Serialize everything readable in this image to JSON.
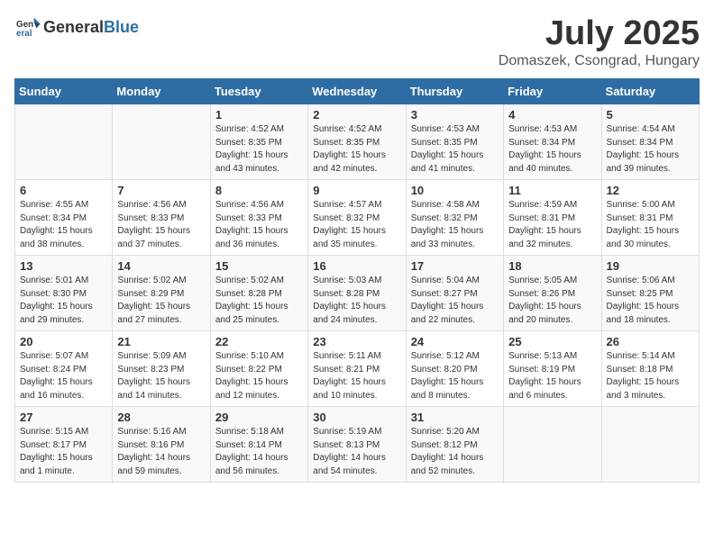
{
  "logo": {
    "general": "General",
    "blue": "Blue"
  },
  "title": {
    "month": "July 2025",
    "location": "Domaszek, Csongrad, Hungary"
  },
  "weekdays": [
    "Sunday",
    "Monday",
    "Tuesday",
    "Wednesday",
    "Thursday",
    "Friday",
    "Saturday"
  ],
  "weeks": [
    [
      {
        "day": "",
        "info": ""
      },
      {
        "day": "",
        "info": ""
      },
      {
        "day": "1",
        "info": "Sunrise: 4:52 AM\nSunset: 8:35 PM\nDaylight: 15 hours\nand 43 minutes."
      },
      {
        "day": "2",
        "info": "Sunrise: 4:52 AM\nSunset: 8:35 PM\nDaylight: 15 hours\nand 42 minutes."
      },
      {
        "day": "3",
        "info": "Sunrise: 4:53 AM\nSunset: 8:35 PM\nDaylight: 15 hours\nand 41 minutes."
      },
      {
        "day": "4",
        "info": "Sunrise: 4:53 AM\nSunset: 8:34 PM\nDaylight: 15 hours\nand 40 minutes."
      },
      {
        "day": "5",
        "info": "Sunrise: 4:54 AM\nSunset: 8:34 PM\nDaylight: 15 hours\nand 39 minutes."
      }
    ],
    [
      {
        "day": "6",
        "info": "Sunrise: 4:55 AM\nSunset: 8:34 PM\nDaylight: 15 hours\nand 38 minutes."
      },
      {
        "day": "7",
        "info": "Sunrise: 4:56 AM\nSunset: 8:33 PM\nDaylight: 15 hours\nand 37 minutes."
      },
      {
        "day": "8",
        "info": "Sunrise: 4:56 AM\nSunset: 8:33 PM\nDaylight: 15 hours\nand 36 minutes."
      },
      {
        "day": "9",
        "info": "Sunrise: 4:57 AM\nSunset: 8:32 PM\nDaylight: 15 hours\nand 35 minutes."
      },
      {
        "day": "10",
        "info": "Sunrise: 4:58 AM\nSunset: 8:32 PM\nDaylight: 15 hours\nand 33 minutes."
      },
      {
        "day": "11",
        "info": "Sunrise: 4:59 AM\nSunset: 8:31 PM\nDaylight: 15 hours\nand 32 minutes."
      },
      {
        "day": "12",
        "info": "Sunrise: 5:00 AM\nSunset: 8:31 PM\nDaylight: 15 hours\nand 30 minutes."
      }
    ],
    [
      {
        "day": "13",
        "info": "Sunrise: 5:01 AM\nSunset: 8:30 PM\nDaylight: 15 hours\nand 29 minutes."
      },
      {
        "day": "14",
        "info": "Sunrise: 5:02 AM\nSunset: 8:29 PM\nDaylight: 15 hours\nand 27 minutes."
      },
      {
        "day": "15",
        "info": "Sunrise: 5:02 AM\nSunset: 8:28 PM\nDaylight: 15 hours\nand 25 minutes."
      },
      {
        "day": "16",
        "info": "Sunrise: 5:03 AM\nSunset: 8:28 PM\nDaylight: 15 hours\nand 24 minutes."
      },
      {
        "day": "17",
        "info": "Sunrise: 5:04 AM\nSunset: 8:27 PM\nDaylight: 15 hours\nand 22 minutes."
      },
      {
        "day": "18",
        "info": "Sunrise: 5:05 AM\nSunset: 8:26 PM\nDaylight: 15 hours\nand 20 minutes."
      },
      {
        "day": "19",
        "info": "Sunrise: 5:06 AM\nSunset: 8:25 PM\nDaylight: 15 hours\nand 18 minutes."
      }
    ],
    [
      {
        "day": "20",
        "info": "Sunrise: 5:07 AM\nSunset: 8:24 PM\nDaylight: 15 hours\nand 16 minutes."
      },
      {
        "day": "21",
        "info": "Sunrise: 5:09 AM\nSunset: 8:23 PM\nDaylight: 15 hours\nand 14 minutes."
      },
      {
        "day": "22",
        "info": "Sunrise: 5:10 AM\nSunset: 8:22 PM\nDaylight: 15 hours\nand 12 minutes."
      },
      {
        "day": "23",
        "info": "Sunrise: 5:11 AM\nSunset: 8:21 PM\nDaylight: 15 hours\nand 10 minutes."
      },
      {
        "day": "24",
        "info": "Sunrise: 5:12 AM\nSunset: 8:20 PM\nDaylight: 15 hours\nand 8 minutes."
      },
      {
        "day": "25",
        "info": "Sunrise: 5:13 AM\nSunset: 8:19 PM\nDaylight: 15 hours\nand 6 minutes."
      },
      {
        "day": "26",
        "info": "Sunrise: 5:14 AM\nSunset: 8:18 PM\nDaylight: 15 hours\nand 3 minutes."
      }
    ],
    [
      {
        "day": "27",
        "info": "Sunrise: 5:15 AM\nSunset: 8:17 PM\nDaylight: 15 hours\nand 1 minute."
      },
      {
        "day": "28",
        "info": "Sunrise: 5:16 AM\nSunset: 8:16 PM\nDaylight: 14 hours\nand 59 minutes."
      },
      {
        "day": "29",
        "info": "Sunrise: 5:18 AM\nSunset: 8:14 PM\nDaylight: 14 hours\nand 56 minutes."
      },
      {
        "day": "30",
        "info": "Sunrise: 5:19 AM\nSunset: 8:13 PM\nDaylight: 14 hours\nand 54 minutes."
      },
      {
        "day": "31",
        "info": "Sunrise: 5:20 AM\nSunset: 8:12 PM\nDaylight: 14 hours\nand 52 minutes."
      },
      {
        "day": "",
        "info": ""
      },
      {
        "day": "",
        "info": ""
      }
    ]
  ]
}
